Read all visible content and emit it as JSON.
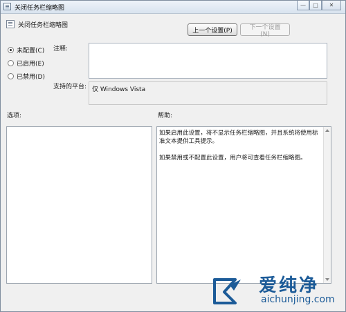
{
  "window": {
    "title": "关闭任务栏缩略图",
    "caption": {
      "minimize": "—",
      "maximize": "□",
      "close": "✕"
    }
  },
  "setting": {
    "title": "关闭任务栏缩略图",
    "prev_button": "上一个设置(P)",
    "next_button": "下一个设置(N)"
  },
  "state": {
    "options": [
      {
        "label": "未配置(C)",
        "checked": true
      },
      {
        "label": "已启用(E)",
        "checked": false
      },
      {
        "label": "已禁用(D)",
        "checked": false
      }
    ]
  },
  "comment": {
    "label": "注释:",
    "value": ""
  },
  "platform": {
    "label": "支持的平台:",
    "value": "仅 Windows Vista"
  },
  "options_panel": {
    "label": "选项:"
  },
  "help_panel": {
    "label": "帮助:",
    "paragraph1": "如果启用此设置，将不显示任务栏缩略图，并且系统将使用标准文本提供工具提示。",
    "paragraph2": "如果禁用或不配置此设置，用户将可查看任务栏缩略图。"
  },
  "watermark": {
    "brand": "爱纯净",
    "url": "aichunjing.com"
  }
}
